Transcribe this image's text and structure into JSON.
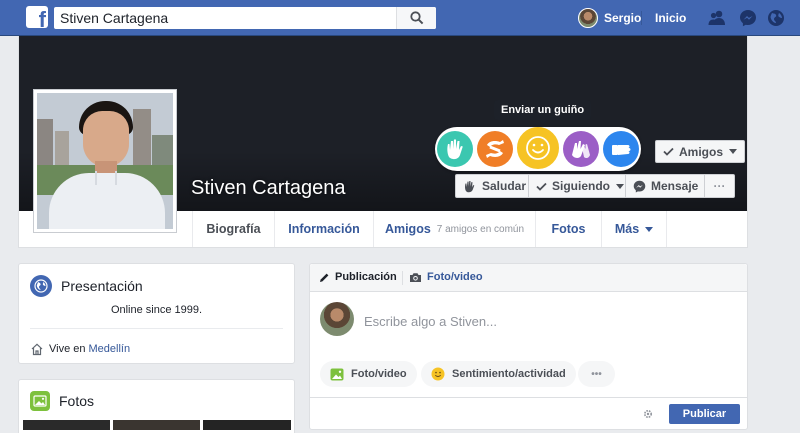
{
  "topbar": {
    "search_value": "Stiven Cartagena",
    "user_name": "Sergio",
    "home_label": "Inicio",
    "brand_color": "#4267b2"
  },
  "profile": {
    "name": "Stiven Cartagena",
    "wave_tooltip": "Enviar un guiño",
    "wave_icons": [
      "wave-hand-icon",
      "hug-icon",
      "smile-icon",
      "high-five-icon",
      "fist-bump-icon"
    ],
    "friends_button": "Amigos",
    "greet_button": "Saludar",
    "following_button": "Siguiendo",
    "message_button": "Mensaje",
    "more_button": "···"
  },
  "tabs": {
    "biography": "Biografía",
    "info": "Información",
    "friends": "Amigos",
    "friends_sub": "7 amigos en común",
    "photos": "Fotos",
    "more": "Más"
  },
  "intro": {
    "title": "Presentación",
    "bio": "Online since 1999.",
    "lives_prefix": "Vive en",
    "lives_city": "Medellín"
  },
  "photos_card": {
    "title": "Fotos"
  },
  "composer": {
    "tab_post": "Publicación",
    "tab_photo": "Foto/video",
    "placeholder": "Escribe algo a Stiven...",
    "pill_photo": "Foto/video",
    "pill_feeling": "Sentimiento/actividad",
    "pill_more": "•••",
    "publish": "Publicar"
  }
}
